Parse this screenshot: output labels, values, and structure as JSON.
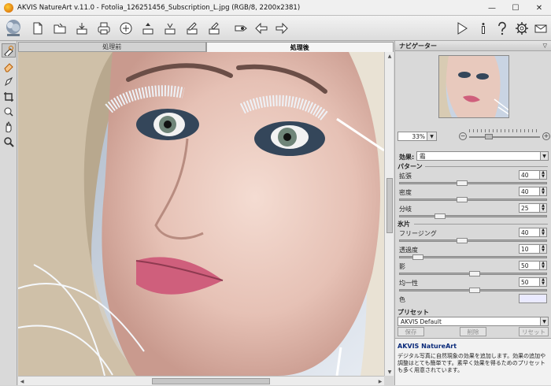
{
  "window": {
    "title": "AKVIS NatureArt v.11.0 - Fotolia_126251456_Subscription_L.jpg (RGB/8, 2200x2381)",
    "minimize": "—",
    "maximize": "☐",
    "close": "✕"
  },
  "toolbar": {
    "icons": [
      "new-file-icon",
      "open-file-icon",
      "save-icon",
      "print-icon",
      "share-icon",
      "export-icon",
      "batch-icon",
      "edit-icon",
      "settings-file-icon",
      "plugin-icon",
      "undo-icon",
      "redo-icon",
      "run-icon",
      "info-icon",
      "help-icon",
      "preferences-icon",
      "news-icon"
    ]
  },
  "left_tools": [
    "pre-selection-icon",
    "eraser-icon",
    "brush-icon",
    "crop-icon",
    "hand-cursor-icon",
    "pan-icon",
    "zoom-icon"
  ],
  "tabs": {
    "before": "処理前",
    "after": "処理後"
  },
  "navigator": {
    "title": "ナビゲーター",
    "zoom_value": "33%",
    "minus": "−",
    "plus": "+"
  },
  "effect": {
    "label": "効果:",
    "value": "霜"
  },
  "pattern": {
    "title": "パターン",
    "params": [
      {
        "label": "拡張",
        "value": "40"
      },
      {
        "label": "密度",
        "value": "40"
      },
      {
        "label": "分岐",
        "value": "25"
      }
    ]
  },
  "ice": {
    "title": "氷片",
    "params": [
      {
        "label": "フリージング",
        "value": "40"
      },
      {
        "label": "透過度",
        "value": "10"
      },
      {
        "label": "影",
        "value": "50"
      },
      {
        "label": "均一性",
        "value": "50"
      }
    ],
    "color_label": "色",
    "color": "#eaeaff"
  },
  "presets": {
    "title": "プリセット",
    "value": "AKVIS Default",
    "save": "保存",
    "delete": "削除",
    "reset": "リセット"
  },
  "info": {
    "title": "AKVIS NatureArt",
    "body": "デジタル写真に自然現象の効果を追加します。効果の追加や調整はとても簡単です。素早く効果を得るためのプリセットも多く用意されています。"
  }
}
